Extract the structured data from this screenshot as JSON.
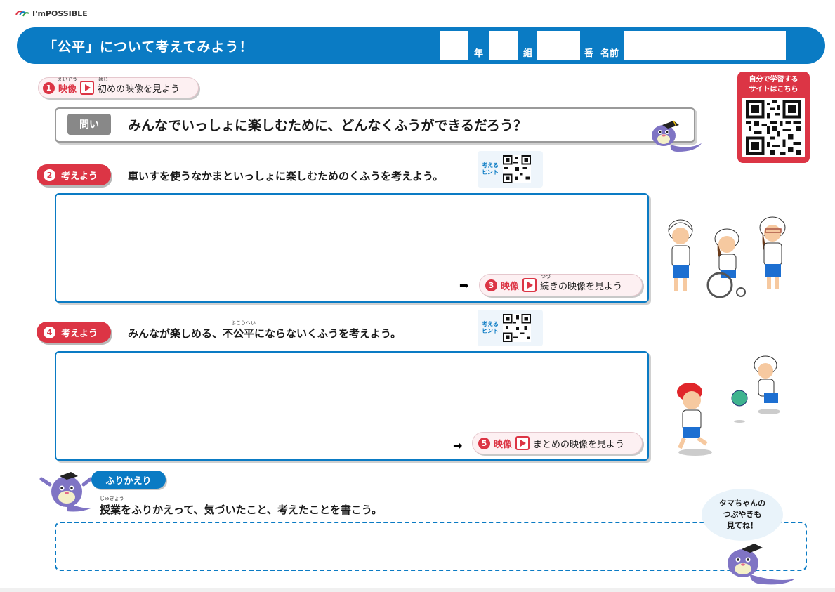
{
  "logo": {
    "text": "I'mPOSSIBLE"
  },
  "header": {
    "title": "「公平」について考えてみよう！",
    "year_label": "年",
    "class_label": "組",
    "number_label": "番",
    "name_label": "名前"
  },
  "step1": {
    "number": "1",
    "eizo": "映像",
    "eizo_ruby": "えいぞう",
    "text": "初めの映像を見よう",
    "text_ruby": "はじ"
  },
  "question": {
    "tag": "問い",
    "text": "みんなでいっしょに楽しむために、どんなくふうができるだろう？"
  },
  "site_card": {
    "line1": "自分で学習する",
    "line2": "サイトはこちら"
  },
  "step2": {
    "number": "2",
    "tag": "考えよう",
    "text": "車いすを使うなかまといっしょに楽しむためのくふうを考えよう。",
    "hint_line1": "考える",
    "hint_line2": "ヒント"
  },
  "step3": {
    "number": "3",
    "eizo": "映像",
    "text": "続きの映像を見よう",
    "text_ruby": "つづ"
  },
  "step4": {
    "number": "4",
    "tag": "考えよう",
    "text": "みんなが楽しめる、不公平にならないくふうを考えよう。",
    "text_ruby": "ふこうへい",
    "hint_line1": "考える",
    "hint_line2": "ヒント"
  },
  "step5": {
    "number": "5",
    "eizo": "映像",
    "text": "まとめの映像を見よう"
  },
  "reflection": {
    "tag": "ふりかえり",
    "ruby": "じゅぎょう",
    "text": "授業をふりかえって、気づいたこと、考えたことを書こう。"
  },
  "bubble": {
    "line1": "タマちゃんの",
    "line2": "つぶやきも",
    "line3": "見てね！"
  },
  "colors": {
    "primary_blue": "#0a7bc4",
    "accent_red": "#dc3545",
    "mascot_purple": "#7f74c4"
  },
  "icons": [
    "play-icon",
    "qr-code-icon",
    "arrow-right-icon",
    "paralympic-logo-icon"
  ]
}
